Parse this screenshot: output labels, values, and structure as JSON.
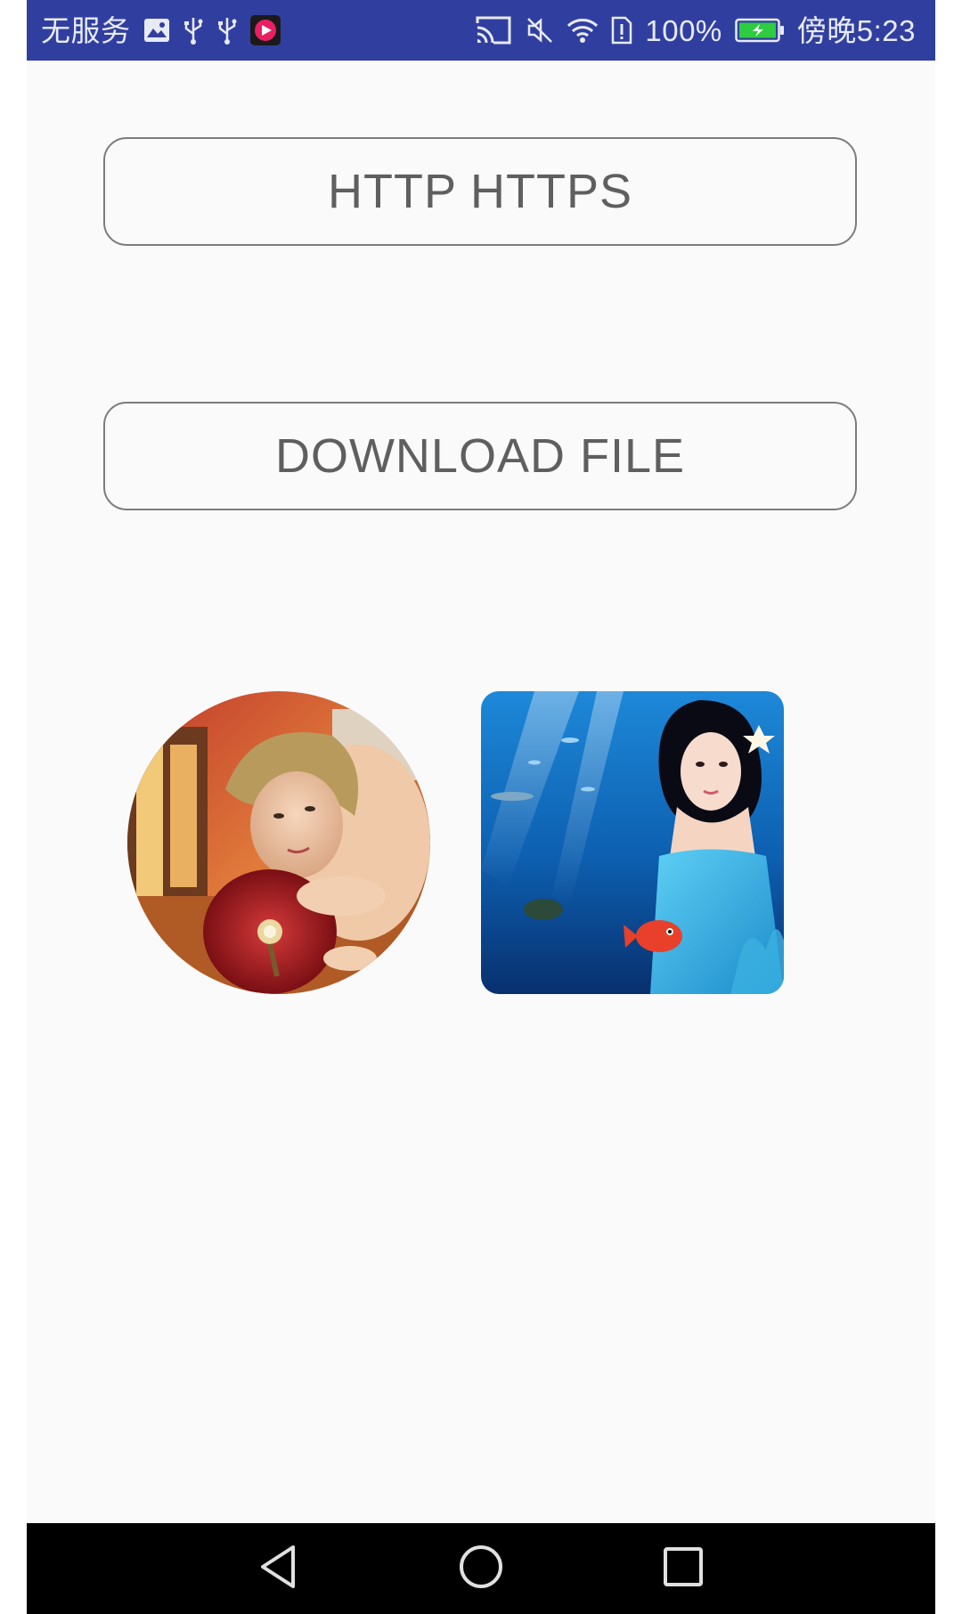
{
  "status_bar": {
    "carrier": "无服务",
    "battery_percent": "100%",
    "time": "傍晚5:23",
    "icons_left": [
      "gallery-icon",
      "usb-icon",
      "usb-icon",
      "media-app-icon"
    ],
    "icons_right": [
      "cast-icon",
      "mute-icon",
      "wifi-icon",
      "sim-alert-icon",
      "battery-charging-icon"
    ],
    "bg_color": "#303f9f"
  },
  "main": {
    "http_button_label": "HTTP HTTPS",
    "download_button_label": "DOWNLOAD FILE",
    "images": [
      {
        "shape": "circle",
        "subject": "portrait photo"
      },
      {
        "shape": "rounded-square",
        "subject": "underwater mermaid photo"
      }
    ]
  },
  "nav_bar": {
    "buttons": [
      "back-icon",
      "home-icon",
      "recents-icon"
    ],
    "bg_color": "#000000"
  }
}
